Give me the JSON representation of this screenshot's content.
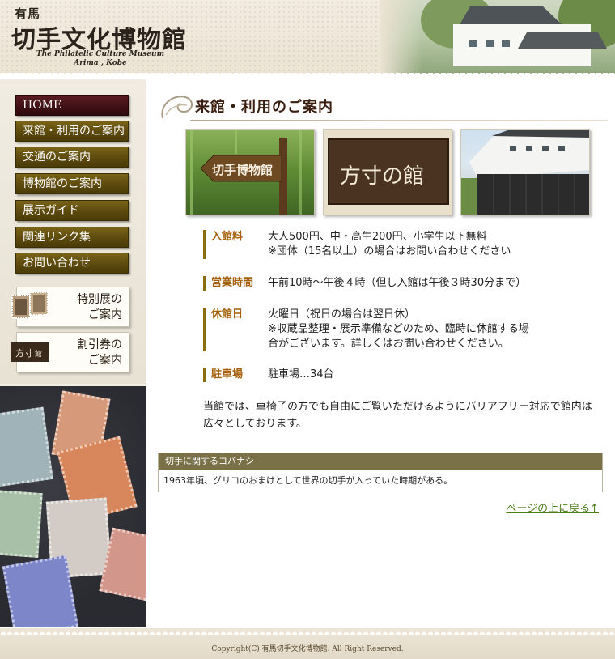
{
  "header": {
    "logo_small": "有馬",
    "logo_main": "切手文化博物館",
    "logo_en_line1": "The Philatelic Culture Museum",
    "logo_en_line2": "Arima , Kobe"
  },
  "nav": {
    "items": [
      {
        "label": "HOME"
      },
      {
        "label": "来館・利用のご案内"
      },
      {
        "label": "交通のご案内"
      },
      {
        "label": "博物館のご案内"
      },
      {
        "label": "展示ガイド"
      },
      {
        "label": "関連リンク集"
      },
      {
        "label": "お問い合わせ"
      }
    ],
    "promo_special_line1": "特別展の",
    "promo_special_line2": "ご案内",
    "promo_discount_line1": "割引券の",
    "promo_discount_line2": "ご案内"
  },
  "main": {
    "title": "来館・利用のご案内",
    "photo_signs": {
      "arrow_sign": "切手博物館",
      "plaque": "方寸の館"
    },
    "info": [
      {
        "label": "入館料",
        "lines": [
          "大人500円、中・高生200円、小学生以下無料",
          "※団体（15名以上）の場合はお問い合わせください"
        ]
      },
      {
        "label": "営業時間",
        "lines": [
          "午前10時～午後４時（但し入館は午後３時30分まで）"
        ]
      },
      {
        "label": "休館日",
        "lines": [
          "火曜日（祝日の場合は翌日休）",
          "※収蔵品整理・展示準備などのため、臨時に休館する場合がございます。詳しくはお問い合わせください。"
        ]
      },
      {
        "label": "駐車場",
        "lines": [
          "駐車場…34台"
        ]
      }
    ],
    "paragraph": "当館では、車椅子の方でも自由にご覧いただけるようにバリアフリー対応で館内は広々としております。",
    "kobanashi_title": "切手に関するコバナシ",
    "kobanashi_text": "1963年頃、グリコのおまけとして世界の切手が入っていた時期がある。",
    "back_to_top": "ページの上に戻る↑"
  },
  "footer": {
    "copyright": "Copyright(C) 有馬切手文化博物館. All Right Reserved."
  },
  "colors": {
    "nav_button": "#5c4a0e",
    "nav_active": "#3e1015",
    "label_text": "#a5610a",
    "label_bar": "#8c6d0c",
    "kobanashi_header": "#7a7148",
    "link": "#4c7f1a"
  }
}
